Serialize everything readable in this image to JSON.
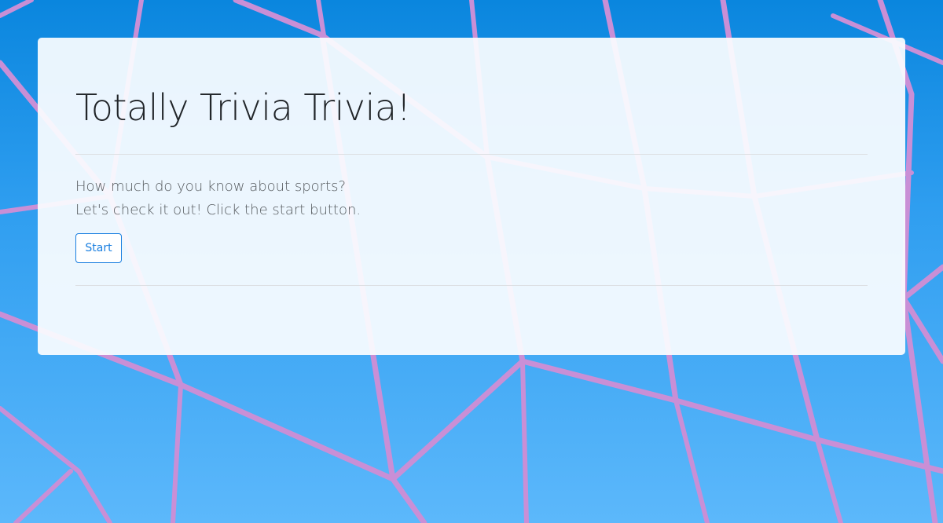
{
  "page": {
    "background_image": "soccer-goal-net-against-blue-sky",
    "colors": {
      "sky_top": "#0a86de",
      "sky_bottom": "#5cb8fb",
      "net": "#c98fd6",
      "panel": "#fbfdff",
      "accent": "#1a7fe0"
    }
  },
  "intro": {
    "title": "Totally Trivia Trivia!",
    "line1": "How much do you know about sports?",
    "line2": "Let's check it out! Click the start button.",
    "start_label": "Start"
  }
}
